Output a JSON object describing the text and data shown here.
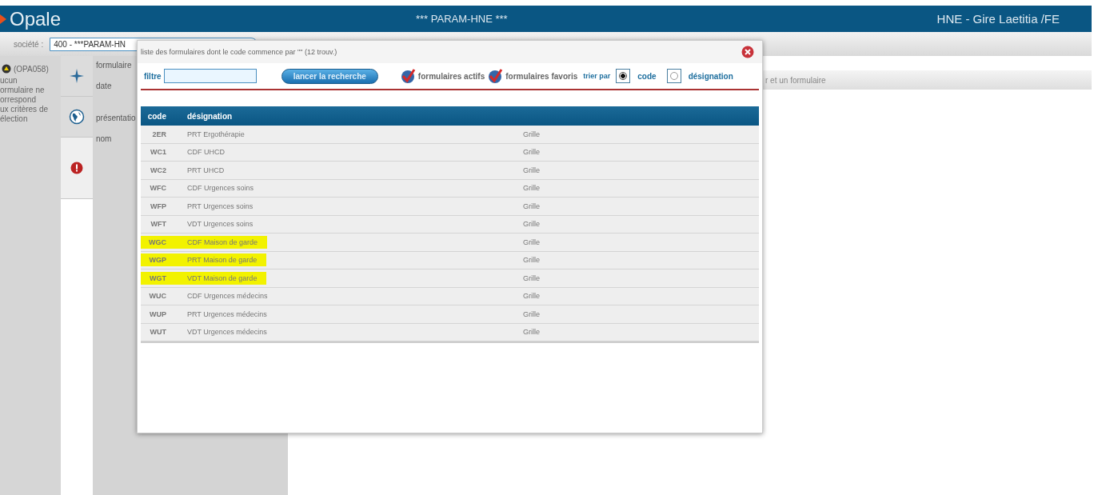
{
  "header": {
    "logo": "Opale",
    "title": "*** PARAM-HNE ***",
    "user": "HNE - Gire Laetitia /FE"
  },
  "company": {
    "label": "société :",
    "value": "400 - ***PARAM-HN"
  },
  "message": {
    "code": "(OPA058)",
    "text": "ucun\normulaire ne\norrespond\nux critères de\nélection"
  },
  "side_tabs": [
    {
      "kind": "add",
      "selected": false
    },
    {
      "kind": "globe",
      "selected": false
    },
    {
      "kind": "alert",
      "selected": true
    }
  ],
  "form_labels": [
    {
      "label": "formulaire"
    },
    {
      "label": "date"
    },
    {
      "label": "présentatio"
    },
    {
      "label": "nom"
    }
  ],
  "hint_bar": {
    "text": "r et un formulaire"
  },
  "dialog": {
    "title": "liste des formulaires  dont le code commence par  \"\" (12 trouv.)",
    "filter_label": "filtre",
    "search_button": "lancer la recherche",
    "checks": [
      {
        "label": "formulaires actifs",
        "checked": true
      },
      {
        "label": "formulaires favoris",
        "checked": true
      }
    ],
    "sort_label": "trier par",
    "sort_options": [
      {
        "label": "code",
        "selected": true
      },
      {
        "label": "désignation",
        "selected": false
      }
    ],
    "columns": [
      "code",
      "désignation"
    ],
    "rows": [
      {
        "code": "2ER",
        "designation": "PRT Ergothérapie",
        "type": "Grille",
        "highlighted": false
      },
      {
        "code": "WC1",
        "designation": "CDF UHCD",
        "type": "Grille",
        "highlighted": false
      },
      {
        "code": "WC2",
        "designation": "PRT UHCD",
        "type": "Grille",
        "highlighted": false
      },
      {
        "code": "WFC",
        "designation": "CDF Urgences soins",
        "type": "Grille",
        "highlighted": false
      },
      {
        "code": "WFP",
        "designation": "PRT Urgences soins",
        "type": "Grille",
        "highlighted": false
      },
      {
        "code": "WFT",
        "designation": "VDT Urgences soins",
        "type": "Grille",
        "highlighted": false
      },
      {
        "code": "WGC",
        "designation": "CDF Maison de garde",
        "type": "Grille",
        "highlighted": true
      },
      {
        "code": "WGP",
        "designation": "PRT Maison de garde",
        "type": "Grille",
        "highlighted": true
      },
      {
        "code": "WGT",
        "designation": "VDT Maison de garde",
        "type": "Grille",
        "highlighted": true
      },
      {
        "code": "WUC",
        "designation": "CDF Urgences médecins",
        "type": "Grille",
        "highlighted": false
      },
      {
        "code": "WUP",
        "designation": "PRT Urgences médecins",
        "type": "Grille",
        "highlighted": false
      },
      {
        "code": "WUT",
        "designation": "VDT Urgences médecins",
        "type": "Grille",
        "highlighted": false
      }
    ]
  }
}
